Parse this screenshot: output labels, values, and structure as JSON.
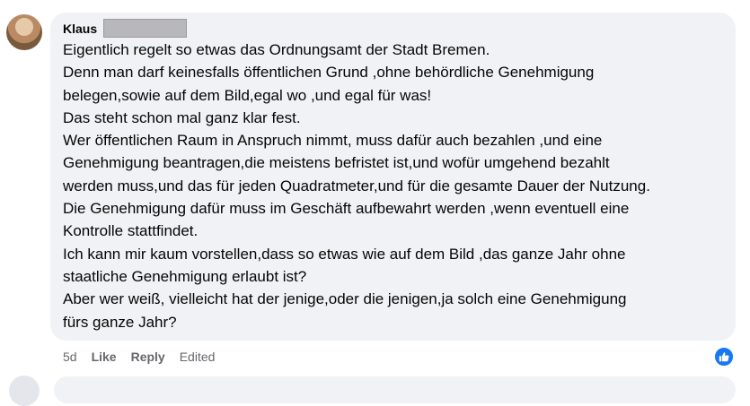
{
  "comment": {
    "author": "Klaus",
    "lines": [
      "Eigentlich regelt so etwas das Ordnungsamt der Stadt Bremen.",
      "Denn man darf keinesfalls öffentlichen Grund ,ohne behördliche Genehmigung",
      "belegen,sowie auf dem Bild,egal wo ,und egal für was!",
      "Das steht schon mal ganz klar fest.",
      "Wer öffentlichen Raum in Anspruch nimmt, muss dafür auch bezahlen ,und eine",
      "Genehmigung beantragen,die meistens befristet ist,und wofür umgehend bezahlt",
      "werden muss,und das für jeden Quadratmeter,und für die gesamte Dauer der Nutzung.",
      "Die Genehmigung dafür muss im Geschäft aufbewahrt werden ,wenn eventuell eine",
      "Kontrolle stattfindet.",
      "Ich kann mir kaum vorstellen,dass so etwas wie auf dem Bild ,das ganze Jahr ohne",
      "staatliche Genehmigung erlaubt ist?",
      "Aber wer weiß, vielleicht hat der jenige,oder die jenigen,ja solch eine Genehmigung",
      "fürs ganze Jahr?"
    ],
    "time": "5d",
    "like_label": "Like",
    "reply_label": "Reply",
    "edited_label": "Edited"
  },
  "reaction_icon": "thumbs-up-icon",
  "colors": {
    "bubble": "#f0f2f5",
    "muted": "#65676b",
    "like_blue": "#1877f2"
  }
}
